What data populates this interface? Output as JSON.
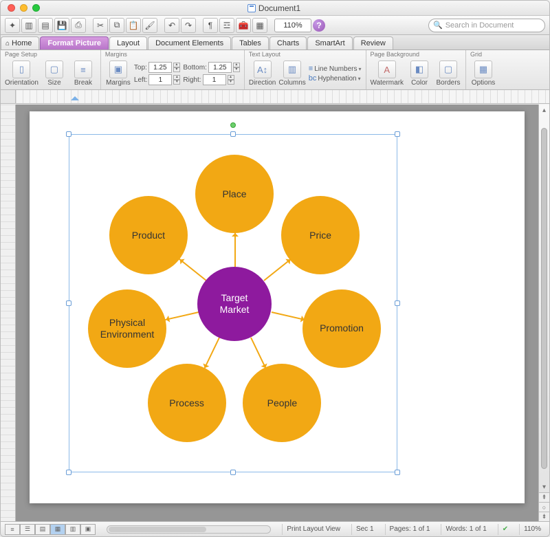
{
  "window": {
    "title": "Document1"
  },
  "smalltb": {
    "zoom": "110%",
    "search_placeholder": "Search in Document"
  },
  "tabs": {
    "home": "Home",
    "format_picture": "Format Picture",
    "layout": "Layout",
    "document_elements": "Document Elements",
    "tables": "Tables",
    "charts": "Charts",
    "smartart": "SmartArt",
    "review": "Review"
  },
  "ribbon": {
    "page_setup": {
      "label": "Page Setup",
      "orientation": "Orientation",
      "size": "Size",
      "break": "Break"
    },
    "margins": {
      "label": "Margins",
      "margins_btn": "Margins",
      "top": "Top:",
      "top_val": "1.25",
      "bottom": "Bottom:",
      "bottom_val": "1.25",
      "left": "Left:",
      "left_val": "1",
      "right": "Right:",
      "right_val": "1"
    },
    "text_layout": {
      "label": "Text Layout",
      "direction": "Direction",
      "columns": "Columns",
      "line_numbers": "Line Numbers",
      "hyphenation": "Hyphenation"
    },
    "page_background": {
      "label": "Page Background",
      "watermark": "Watermark",
      "color": "Color",
      "borders": "Borders"
    },
    "grid": {
      "label": "Grid",
      "options": "Options"
    }
  },
  "diagram": {
    "center": "Target\nMarket",
    "nodes": [
      "Place",
      "Price",
      "Promotion",
      "People",
      "Process",
      "Physical Environment",
      "Product"
    ]
  },
  "statusbar": {
    "view": "Print Layout View",
    "sec": "Sec   1",
    "pages": "Pages:    1 of 1",
    "words": "Words:    1 of 1",
    "zoom": "110%"
  }
}
